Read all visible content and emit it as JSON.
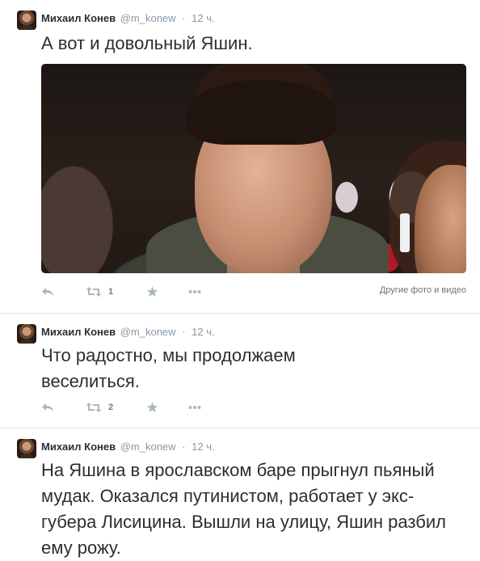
{
  "tweets": [
    {
      "author_name": "Михаил Конев",
      "handle": "@m_konew",
      "separator": "·",
      "time": "12 ч.",
      "text": "А вот и довольный Яшин.",
      "retweet_count": "1",
      "media_link": "Другие фото и видео"
    },
    {
      "author_name": "Михаил Конев",
      "handle": "@m_konew",
      "separator": "·",
      "time": "12 ч.",
      "text": "Что радостно, мы продолжаем веселиться.",
      "retweet_count": "2"
    },
    {
      "author_name": "Михаил Конев",
      "handle": "@m_konew",
      "separator": "·",
      "time": "12 ч.",
      "text": "На Яшина в ярославском баре прыгнул пьяный мудак. Оказался путинистом, работает у экс-губера Лисицина. Вышли на улицу, Яшин разбил ему рожу."
    }
  ],
  "icons": {
    "reply": "reply-icon",
    "retweet": "retweet-icon",
    "favorite": "star-icon",
    "more": "more-icon"
  },
  "colors": {
    "text": "#292f33",
    "meta": "#8899a6",
    "action_icon": "#aab8c2",
    "divider": "#e1e8ed"
  }
}
